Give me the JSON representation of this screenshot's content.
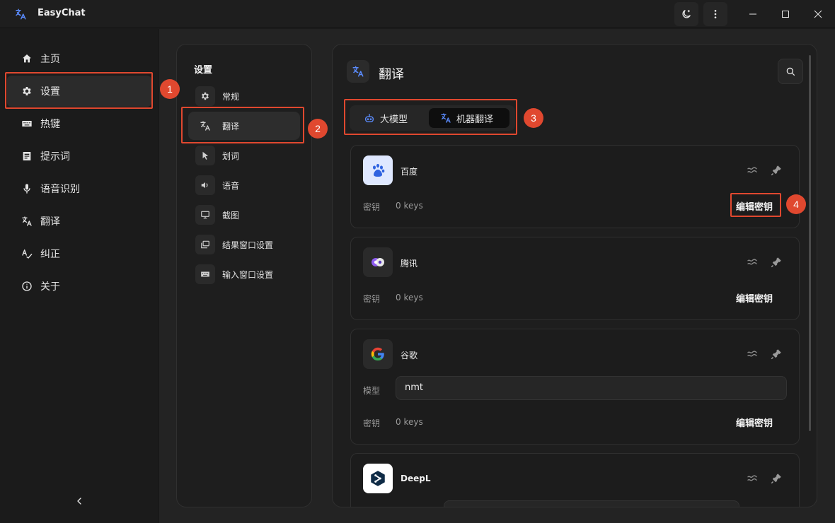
{
  "app": {
    "title": "EasyChat"
  },
  "sidebar": {
    "items": [
      {
        "label": "主页",
        "icon": "home-icon"
      },
      {
        "label": "设置",
        "icon": "gear-icon"
      },
      {
        "label": "热键",
        "icon": "keyboard-icon"
      },
      {
        "label": "提示词",
        "icon": "prompt-icon"
      },
      {
        "label": "语音识别",
        "icon": "microphone-icon"
      },
      {
        "label": "翻译",
        "icon": "translate-icon"
      },
      {
        "label": "纠正",
        "icon": "spellcheck-icon"
      },
      {
        "label": "关于",
        "icon": "info-icon"
      }
    ],
    "active": "设置"
  },
  "settings_panel": {
    "title": "设置",
    "items": [
      {
        "label": "常规",
        "icon": "gear-icon"
      },
      {
        "label": "翻译",
        "icon": "translate-icon"
      },
      {
        "label": "划词",
        "icon": "cursor-icon"
      },
      {
        "label": "语音",
        "icon": "speaker-icon"
      },
      {
        "label": "截图",
        "icon": "monitor-icon"
      },
      {
        "label": "结果窗口设置",
        "icon": "window-icon"
      },
      {
        "label": "输入窗口设置",
        "icon": "keyboard-icon"
      }
    ],
    "active": "翻译"
  },
  "main": {
    "title": "翻译",
    "tabs": [
      {
        "label": "大模型",
        "icon": "robot-icon"
      },
      {
        "label": "机器翻译",
        "icon": "translate-icon"
      }
    ],
    "active_tab": "机器翻译",
    "providers": [
      {
        "name": "百度",
        "key_label": "密钥",
        "key_value": "0 keys",
        "edit_label": "编辑密钥"
      },
      {
        "name": "腾讯",
        "key_label": "密钥",
        "key_value": "0 keys",
        "edit_label": "编辑密钥"
      },
      {
        "name": "谷歌",
        "model_label": "模型",
        "model_value": "nmt",
        "key_label": "密钥",
        "key_value": "0 keys",
        "edit_label": "编辑密钥"
      },
      {
        "name": "DeepL"
      }
    ]
  },
  "annotations": [
    "1",
    "2",
    "3",
    "4"
  ],
  "colors": {
    "highlight": "#e0482f",
    "accent": "#4f7cff",
    "background": "#1c1c1c"
  }
}
